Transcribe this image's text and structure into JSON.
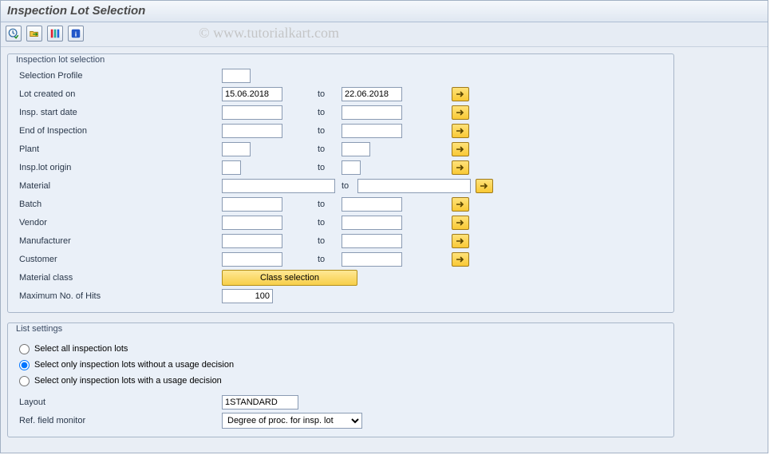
{
  "title": "Inspection Lot Selection",
  "watermark": "© www.tutorialkart.com",
  "toolbar": {
    "btn1": "execute-icon",
    "btn2": "get-variant-icon",
    "btn3": "color-legend-icon",
    "btn4": "info-icon"
  },
  "group1": {
    "title": "Inspection lot selection",
    "rows": {
      "selprof": {
        "label": "Selection Profile",
        "from": ""
      },
      "created": {
        "label": "Lot created on",
        "from": "15.06.2018",
        "to_lbl": "to",
        "to": "22.06.2018"
      },
      "start": {
        "label": "Insp. start date",
        "from": "",
        "to_lbl": "to",
        "to": ""
      },
      "end": {
        "label": "End of Inspection",
        "from": "",
        "to_lbl": "to",
        "to": ""
      },
      "plant": {
        "label": "Plant",
        "from": "",
        "to_lbl": "to",
        "to": ""
      },
      "origin": {
        "label": "Insp.lot origin",
        "from": "",
        "to_lbl": "to",
        "to": ""
      },
      "material": {
        "label": "Material",
        "from": "",
        "to_lbl": "to",
        "to": ""
      },
      "batch": {
        "label": "Batch",
        "from": "",
        "to_lbl": "to",
        "to": ""
      },
      "vendor": {
        "label": "Vendor",
        "from": "",
        "to_lbl": "to",
        "to": ""
      },
      "manuf": {
        "label": "Manufacturer",
        "from": "",
        "to_lbl": "to",
        "to": ""
      },
      "customer": {
        "label": "Customer",
        "from": "",
        "to_lbl": "to",
        "to": ""
      },
      "matclass": {
        "label": "Material class",
        "button": "Class selection"
      },
      "maxhits": {
        "label": "Maximum No. of Hits",
        "value": "100"
      }
    }
  },
  "group2": {
    "title": "List settings",
    "radio1": "Select all inspection lots",
    "radio2": "Select only inspection lots without a usage decision",
    "radio3": "Select only inspection lots with a usage decision",
    "selected_radio": 2,
    "layout_label": "Layout",
    "layout_value": "1STANDARD",
    "ref_label": "Ref. field monitor",
    "ref_value": "Degree of proc. for insp. lot"
  }
}
